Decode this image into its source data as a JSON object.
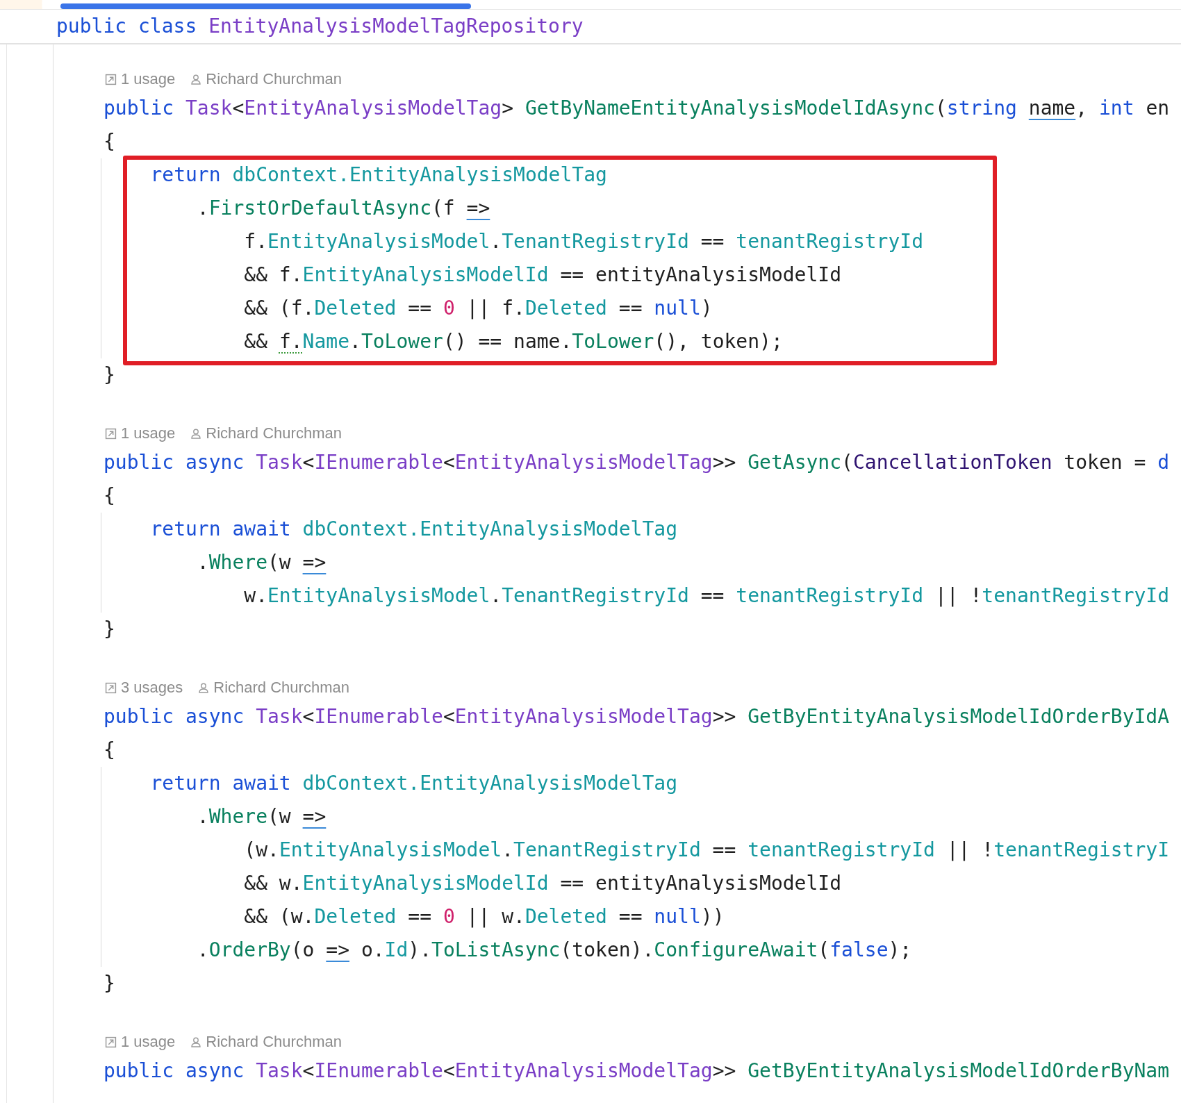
{
  "header": {
    "tokens": [
      {
        "text": "public class ",
        "kind": "keyword"
      },
      {
        "text": "EntityAnalysisModelTagRepository",
        "kind": "type"
      }
    ]
  },
  "blocks": [
    {
      "usages": "1 usage",
      "author": "Richard Churchman",
      "highlighted": true,
      "lines": [
        {
          "kind": "signature",
          "tokens": [
            {
              "text": "public ",
              "kind": "keyword"
            },
            {
              "text": "Task",
              "kind": "type"
            },
            {
              "text": "<",
              "kind": "plain"
            },
            {
              "text": "EntityAnalysisModelTag",
              "kind": "type"
            },
            {
              "text": "> ",
              "kind": "plain"
            },
            {
              "text": "GetByNameEntityAnalysisModelIdAsync",
              "kind": "method"
            },
            {
              "text": "(",
              "kind": "plain"
            },
            {
              "text": "string ",
              "kind": "keyword"
            },
            {
              "text": "name",
              "kind": "underlined"
            },
            {
              "text": ", ",
              "kind": "plain"
            },
            {
              "text": "int ",
              "kind": "keyword"
            },
            {
              "text": "en",
              "kind": "plain"
            }
          ]
        },
        {
          "kind": "brace",
          "tokens": [
            {
              "text": "{",
              "kind": "plain"
            }
          ]
        },
        {
          "kind": "body",
          "tokens": [
            {
              "text": "    return ",
              "kind": "keyword"
            },
            {
              "text": "dbContext.",
              "kind": "member"
            },
            {
              "text": "EntityAnalysisModelTag",
              "kind": "member"
            }
          ]
        },
        {
          "kind": "body",
          "tokens": [
            {
              "text": "        .",
              "kind": "plain"
            },
            {
              "text": "FirstOrDefaultAsync",
              "kind": "method"
            },
            {
              "text": "(f ",
              "kind": "plain"
            },
            {
              "text": "=>",
              "kind": "underlined"
            }
          ]
        },
        {
          "kind": "body",
          "tokens": [
            {
              "text": "            f.",
              "kind": "plain"
            },
            {
              "text": "EntityAnalysisModel",
              "kind": "member"
            },
            {
              "text": ".",
              "kind": "plain"
            },
            {
              "text": "TenantRegistryId",
              "kind": "member"
            },
            {
              "text": " == ",
              "kind": "plain"
            },
            {
              "text": "tenantRegistryId",
              "kind": "member"
            }
          ]
        },
        {
          "kind": "body",
          "tokens": [
            {
              "text": "            && f.",
              "kind": "plain"
            },
            {
              "text": "EntityAnalysisModelId",
              "kind": "member"
            },
            {
              "text": " == entityAnalysisModelId",
              "kind": "plain"
            }
          ]
        },
        {
          "kind": "body",
          "tokens": [
            {
              "text": "            && (f.",
              "kind": "plain"
            },
            {
              "text": "Deleted",
              "kind": "member"
            },
            {
              "text": " == ",
              "kind": "plain"
            },
            {
              "text": "0",
              "kind": "number"
            },
            {
              "text": " || f.",
              "kind": "plain"
            },
            {
              "text": "Deleted",
              "kind": "member"
            },
            {
              "text": " == ",
              "kind": "plain"
            },
            {
              "text": "null",
              "kind": "keyword"
            },
            {
              "text": ")",
              "kind": "plain"
            }
          ]
        },
        {
          "kind": "body",
          "tokens": [
            {
              "text": "            && ",
              "kind": "plain"
            },
            {
              "text": "f.",
              "kind": "dotted"
            },
            {
              "text": "Name",
              "kind": "member"
            },
            {
              "text": ".",
              "kind": "plain"
            },
            {
              "text": "ToLower",
              "kind": "method"
            },
            {
              "text": "() == name.",
              "kind": "plain"
            },
            {
              "text": "ToLower",
              "kind": "method"
            },
            {
              "text": "(), token);",
              "kind": "plain"
            }
          ]
        },
        {
          "kind": "brace",
          "tokens": [
            {
              "text": "}",
              "kind": "plain"
            }
          ]
        }
      ]
    },
    {
      "usages": "1 usage",
      "author": "Richard Churchman",
      "highlighted": false,
      "lines": [
        {
          "kind": "signature",
          "tokens": [
            {
              "text": "public async ",
              "kind": "keyword"
            },
            {
              "text": "Task",
              "kind": "type"
            },
            {
              "text": "<",
              "kind": "plain"
            },
            {
              "text": "IEnumerable",
              "kind": "type"
            },
            {
              "text": "<",
              "kind": "plain"
            },
            {
              "text": "EntityAnalysisModelTag",
              "kind": "type"
            },
            {
              "text": ">> ",
              "kind": "plain"
            },
            {
              "text": "GetAsync",
              "kind": "method"
            },
            {
              "text": "(",
              "kind": "plain"
            },
            {
              "text": "CancellationToken",
              "kind": "param"
            },
            {
              "text": " token = ",
              "kind": "plain"
            },
            {
              "text": "d",
              "kind": "keyword"
            }
          ]
        },
        {
          "kind": "brace",
          "tokens": [
            {
              "text": "{",
              "kind": "plain"
            }
          ]
        },
        {
          "kind": "body",
          "tokens": [
            {
              "text": "    return await ",
              "kind": "keyword"
            },
            {
              "text": "dbContext.",
              "kind": "member"
            },
            {
              "text": "EntityAnalysisModelTag",
              "kind": "member"
            }
          ]
        },
        {
          "kind": "body",
          "tokens": [
            {
              "text": "        .",
              "kind": "plain"
            },
            {
              "text": "Where",
              "kind": "method"
            },
            {
              "text": "(w ",
              "kind": "plain"
            },
            {
              "text": "=>",
              "kind": "underlined"
            }
          ]
        },
        {
          "kind": "body",
          "tokens": [
            {
              "text": "            w.",
              "kind": "plain"
            },
            {
              "text": "EntityAnalysisModel",
              "kind": "member"
            },
            {
              "text": ".",
              "kind": "plain"
            },
            {
              "text": "TenantRegistryId",
              "kind": "member"
            },
            {
              "text": " == ",
              "kind": "plain"
            },
            {
              "text": "tenantRegistryId",
              "kind": "member"
            },
            {
              "text": " || !",
              "kind": "plain"
            },
            {
              "text": "tenantRegistryId",
              "kind": "member"
            }
          ]
        },
        {
          "kind": "brace",
          "tokens": [
            {
              "text": "}",
              "kind": "plain"
            }
          ]
        }
      ]
    },
    {
      "usages": "3 usages",
      "author": "Richard Churchman",
      "highlighted": false,
      "lines": [
        {
          "kind": "signature",
          "tokens": [
            {
              "text": "public async ",
              "kind": "keyword"
            },
            {
              "text": "Task",
              "kind": "type"
            },
            {
              "text": "<",
              "kind": "plain"
            },
            {
              "text": "IEnumerable",
              "kind": "type"
            },
            {
              "text": "<",
              "kind": "plain"
            },
            {
              "text": "EntityAnalysisModelTag",
              "kind": "type"
            },
            {
              "text": ">> ",
              "kind": "plain"
            },
            {
              "text": "GetByEntityAnalysisModelIdOrderByIdA",
              "kind": "method"
            }
          ]
        },
        {
          "kind": "brace",
          "tokens": [
            {
              "text": "{",
              "kind": "plain"
            }
          ]
        },
        {
          "kind": "body",
          "tokens": [
            {
              "text": "    return await ",
              "kind": "keyword"
            },
            {
              "text": "dbContext.",
              "kind": "member"
            },
            {
              "text": "EntityAnalysisModelTag",
              "kind": "member"
            }
          ]
        },
        {
          "kind": "body",
          "tokens": [
            {
              "text": "        .",
              "kind": "plain"
            },
            {
              "text": "Where",
              "kind": "method"
            },
            {
              "text": "(w ",
              "kind": "plain"
            },
            {
              "text": "=>",
              "kind": "underlined"
            }
          ]
        },
        {
          "kind": "body",
          "tokens": [
            {
              "text": "            (w.",
              "kind": "plain"
            },
            {
              "text": "EntityAnalysisModel",
              "kind": "member"
            },
            {
              "text": ".",
              "kind": "plain"
            },
            {
              "text": "TenantRegistryId",
              "kind": "member"
            },
            {
              "text": " == ",
              "kind": "plain"
            },
            {
              "text": "tenantRegistryId",
              "kind": "member"
            },
            {
              "text": " || !",
              "kind": "plain"
            },
            {
              "text": "tenantRegistryI",
              "kind": "member"
            }
          ]
        },
        {
          "kind": "body",
          "tokens": [
            {
              "text": "            && w.",
              "kind": "plain"
            },
            {
              "text": "EntityAnalysisModelId",
              "kind": "member"
            },
            {
              "text": " == entityAnalysisModelId",
              "kind": "plain"
            }
          ]
        },
        {
          "kind": "body",
          "tokens": [
            {
              "text": "            && (w.",
              "kind": "plain"
            },
            {
              "text": "Deleted",
              "kind": "member"
            },
            {
              "text": " == ",
              "kind": "plain"
            },
            {
              "text": "0",
              "kind": "number"
            },
            {
              "text": " || w.",
              "kind": "plain"
            },
            {
              "text": "Deleted",
              "kind": "member"
            },
            {
              "text": " == ",
              "kind": "plain"
            },
            {
              "text": "null",
              "kind": "keyword"
            },
            {
              "text": "))",
              "kind": "plain"
            }
          ]
        },
        {
          "kind": "body",
          "tokens": [
            {
              "text": "        .",
              "kind": "plain"
            },
            {
              "text": "OrderBy",
              "kind": "method"
            },
            {
              "text": "(o ",
              "kind": "plain"
            },
            {
              "text": "=>",
              "kind": "underlined"
            },
            {
              "text": " o.",
              "kind": "plain"
            },
            {
              "text": "Id",
              "kind": "member"
            },
            {
              "text": ").",
              "kind": "plain"
            },
            {
              "text": "ToListAsync",
              "kind": "method"
            },
            {
              "text": "(token).",
              "kind": "plain"
            },
            {
              "text": "ConfigureAwait",
              "kind": "method"
            },
            {
              "text": "(",
              "kind": "plain"
            },
            {
              "text": "false",
              "kind": "keyword"
            },
            {
              "text": ");",
              "kind": "plain"
            }
          ]
        },
        {
          "kind": "brace",
          "tokens": [
            {
              "text": "}",
              "kind": "plain"
            }
          ]
        }
      ]
    },
    {
      "usages": "1 usage",
      "author": "Richard Churchman",
      "lines": [
        {
          "kind": "signature",
          "tokens": [
            {
              "text": "public async ",
              "kind": "keyword"
            },
            {
              "text": "Task",
              "kind": "type"
            },
            {
              "text": "<",
              "kind": "plain"
            },
            {
              "text": "IEnumerable",
              "kind": "type"
            },
            {
              "text": "<",
              "kind": "plain"
            },
            {
              "text": "EntityAnalysisModelTag",
              "kind": "type"
            },
            {
              "text": ">> ",
              "kind": "plain"
            },
            {
              "text": "GetByEntityAnalysisModelIdOrderByNam",
              "kind": "method"
            }
          ]
        }
      ]
    }
  ]
}
